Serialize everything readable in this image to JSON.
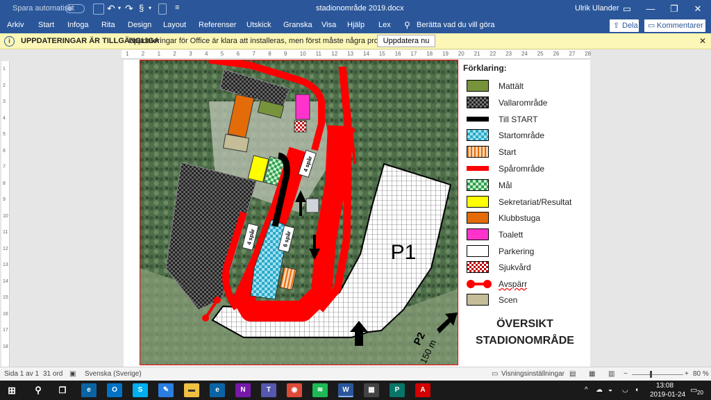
{
  "titlebar": {
    "autosave_label": "Spara automatiskt",
    "doc_title": "stadionområde 2019.docx",
    "user": "Ulrik Ulander"
  },
  "menu": {
    "items": [
      "Arkiv",
      "Start",
      "Infoga",
      "Rita",
      "Design",
      "Layout",
      "Referenser",
      "Utskick",
      "Granska",
      "Visa",
      "Hjälp",
      "Lex"
    ],
    "tell_me": "Berätta vad du vill göra",
    "share": "Dela",
    "comments": "Kommentarer"
  },
  "infobar": {
    "title": "UPPDATERINGAR ÄR TILLGÄNGLIGA",
    "message": "Uppdateringar för Office är klara att installeras, men först måste några program stängas.",
    "button": "Uppdatera nu"
  },
  "ruler": {
    "ticks": [
      "1",
      "2",
      "1",
      "2",
      "3",
      "4",
      "5",
      "6",
      "7",
      "8",
      "9",
      "10",
      "11",
      "12",
      "13",
      "14",
      "15",
      "16",
      "17",
      "18",
      "19",
      "20",
      "21",
      "22",
      "23",
      "24",
      "25",
      "26",
      "27",
      "28"
    ],
    "vticks": [
      "1",
      "2",
      "3",
      "4",
      "5",
      "6",
      "7",
      "8",
      "9",
      "10",
      "11",
      "12",
      "13",
      "14",
      "15",
      "16",
      "17",
      "18"
    ]
  },
  "map": {
    "p1": "P1",
    "p2": "P2",
    "p2_dist": "150 m",
    "track_4a": "4 spår",
    "track_4b": "4 spår",
    "track_6": "6 spår"
  },
  "legend": {
    "title": "Förklaring:",
    "items": [
      {
        "label": "Mattält",
        "color": "#77933c"
      },
      {
        "label": "Vallarområde",
        "color": "#4a4a4a"
      },
      {
        "label": "Till START",
        "color": "#000000"
      },
      {
        "label": "Startområde",
        "color": "#4bacc6"
      },
      {
        "label": "Start",
        "color": "#f79646"
      },
      {
        "label": "Spårområde",
        "color": "#ff0000"
      },
      {
        "label": "Mål",
        "color": "#3cb371"
      },
      {
        "label": "Sekretariat/Resultat",
        "color": "#ffff00"
      },
      {
        "label": "Klubbstuga",
        "color": "#e36c09"
      },
      {
        "label": "Toalett",
        "color": "#ff33cc"
      },
      {
        "label": "Parkering",
        "color": "#ffffff"
      },
      {
        "label": "Sjukvård",
        "color": "#c00000"
      },
      {
        "label": "Avspärr",
        "color": "#ff0000"
      },
      {
        "label": "Scen",
        "color": "#c4bd97"
      }
    ],
    "overview_line1": "ÖVERSIKT",
    "overview_line2": "STADIONOMRÅDE"
  },
  "status": {
    "page": "Sida 1 av 1",
    "words": "31 ord",
    "language": "Svenska (Sverige)",
    "view_settings": "Visningsinställningar",
    "zoom": "80 %"
  },
  "taskbar": {
    "time": "13:08",
    "date": "2019-01-24",
    "notifications": "20"
  }
}
